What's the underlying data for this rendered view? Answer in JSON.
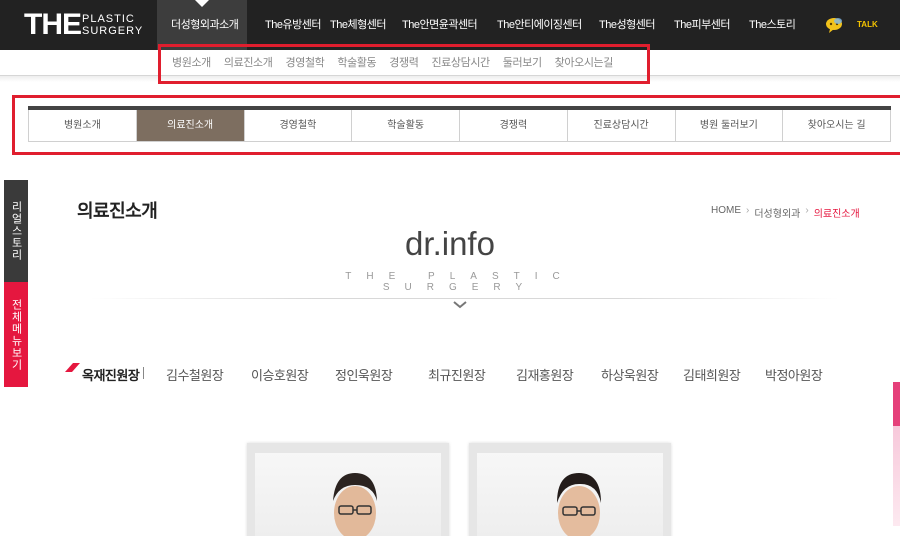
{
  "brand": {
    "the": "THE",
    "line1": "PLASTIC",
    "line2": "SURGERY"
  },
  "gnb": [
    {
      "label": "더성형외과소개",
      "active": true
    },
    {
      "label": "The유방센터"
    },
    {
      "label": "The체형센터"
    },
    {
      "label": "The안면윤곽센터"
    },
    {
      "label": "The안티에이징센터"
    },
    {
      "label": "The성형센터"
    },
    {
      "label": "The피부센터"
    },
    {
      "label": "The스토리"
    }
  ],
  "talk_label": "TALK",
  "submenu": [
    "병원소개",
    "의료진소개",
    "경영철학",
    "학술활동",
    "경쟁력",
    "진료상담시간",
    "둘러보기",
    "찾아오시는길"
  ],
  "tabs": [
    {
      "label": "병원소개"
    },
    {
      "label": "의료진소개",
      "active": true
    },
    {
      "label": "경영철학"
    },
    {
      "label": "학술활동"
    },
    {
      "label": "경쟁력"
    },
    {
      "label": "진료상담시간"
    },
    {
      "label": "병원 둘러보기"
    },
    {
      "label": "찾아오시는 길"
    }
  ],
  "side": {
    "quick": "리얼스토리",
    "all": "전체메뉴보기"
  },
  "page_title": "의료진소개",
  "breadcrumb": [
    "HOME",
    "더성형외과",
    "의료진소개"
  ],
  "hero": {
    "title": "dr.info",
    "subtitle": "THE PLASTIC SURGERY"
  },
  "doctors": [
    {
      "name": "옥재진원장",
      "active": true
    },
    {
      "name": "김수철원장"
    },
    {
      "name": "이승호원장"
    },
    {
      "name": "정인욱원장"
    },
    {
      "name": "최규진원장"
    },
    {
      "name": "김재홍원장"
    },
    {
      "name": "하상욱원장"
    },
    {
      "name": "김태희원장"
    },
    {
      "name": "박정아원장"
    }
  ],
  "colors": {
    "accent": "#e5173f",
    "tab_active": "#7d6e60",
    "topbar": "#222222",
    "highlight_box": "#e01e2e"
  }
}
